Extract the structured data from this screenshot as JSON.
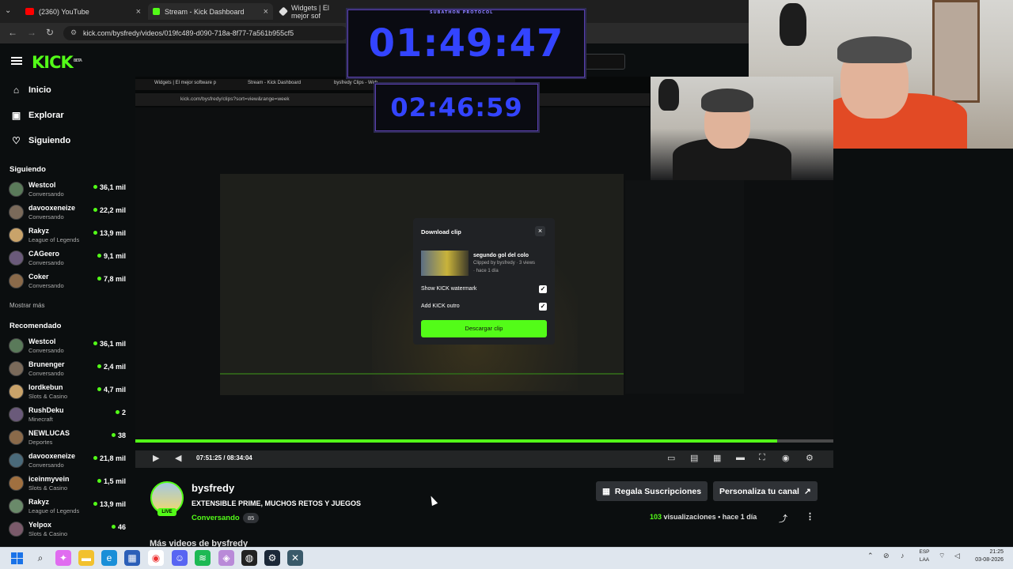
{
  "browser": {
    "tabs": [
      {
        "label": "(2360) YouTube",
        "color": "#ff0000"
      },
      {
        "label": "Stream - Kick Dashboard",
        "color": "#53fc18"
      },
      {
        "label": "Widgets | El mejor sof",
        "color": "#dddddd"
      }
    ],
    "url": "kick.com/bysfredy/videos/019fc489-d090-718a-8f77-7a561b955cf5"
  },
  "sidebar": {
    "logo": "KICK",
    "logo_sup": "BETA",
    "nav": [
      {
        "label": "Inicio",
        "icon": "home-icon"
      },
      {
        "label": "Explorar",
        "icon": "compass-icon"
      },
      {
        "label": "Siguiendo",
        "icon": "heart-icon"
      }
    ],
    "following_title": "Siguiendo",
    "following": [
      {
        "name": "Westcol",
        "category": "Conversando",
        "viewers": "36,1 mil"
      },
      {
        "name": "davooxeneize",
        "category": "Conversando",
        "viewers": "22,2 mil"
      },
      {
        "name": "Rakyz",
        "category": "League of Legends",
        "viewers": "13,9 mil"
      },
      {
        "name": "CAGeero",
        "category": "Conversando",
        "viewers": "9,1 mil"
      },
      {
        "name": "Coker",
        "category": "Conversando",
        "viewers": "7,8 mil"
      }
    ],
    "show_more": "Mostrar más",
    "recommended_title": "Recomendado",
    "recommended": [
      {
        "name": "Westcol",
        "category": "Conversando",
        "viewers": "36,1 mil"
      },
      {
        "name": "Brunenger",
        "category": "Conversando",
        "viewers": "2,4 mil"
      },
      {
        "name": "lordkebun",
        "category": "Slots & Casino",
        "viewers": "4,7 mil"
      },
      {
        "name": "RushDeku",
        "category": "Minecraft",
        "viewers": "2"
      },
      {
        "name": "NEWLUCAS",
        "category": "Deportes",
        "viewers": "38"
      },
      {
        "name": "davooxeneize",
        "category": "Conversando",
        "viewers": "21,8 mil"
      },
      {
        "name": "iceinmyvein",
        "category": "Slots & Casino",
        "viewers": "1,5 mil"
      },
      {
        "name": "Rakyz",
        "category": "League of Legends",
        "viewers": "13,9 mil"
      },
      {
        "name": "Yelpox",
        "category": "Slots & Casino",
        "viewers": "46"
      }
    ]
  },
  "overlay": {
    "timer_main": "01:49:47",
    "timer_secondary": "02:46:59",
    "timer_caption": "SUBATHON PROTOCOL"
  },
  "inner_browser": {
    "tabs": [
      "Widgets | El mejor software p",
      "Stream - Kick Dashboard",
      "bysfredy Clips - Web"
    ],
    "url": "kick.com/bysfredy/clips?sort=view&range=week"
  },
  "modal": {
    "title": "Download clip",
    "close": "×",
    "clip_title": "segundo gol del colo",
    "clip_meta": "Clipped by bysfredy · 3 views",
    "clip_date": "· hace 1 día",
    "options": [
      {
        "label": "Show KICK watermark",
        "checked": "✓"
      },
      {
        "label": "Add KICK outro",
        "checked": "✓"
      }
    ],
    "button": "Descargar clip"
  },
  "player": {
    "time": "07:51:25 / 08:34:04",
    "progress": 0.92
  },
  "channel": {
    "name": "bysfredy",
    "live": "LIVE",
    "title": "EXTENSIBLE PRIME, MUCHOS RETOS Y JUEGOS",
    "category": "Conversando",
    "tag": "85",
    "gift_button": "Regala Suscripciones",
    "customize_button": "Personaliza tu canal",
    "views_count": "103",
    "views_label": "visualizaciones",
    "date": "hace 1 día",
    "more_videos": "Más videos de bysfredy"
  },
  "taskbar": {
    "lang_top": "ESP",
    "lang_bottom": "LAA",
    "time": "21:25",
    "date": "03-08-2026"
  }
}
